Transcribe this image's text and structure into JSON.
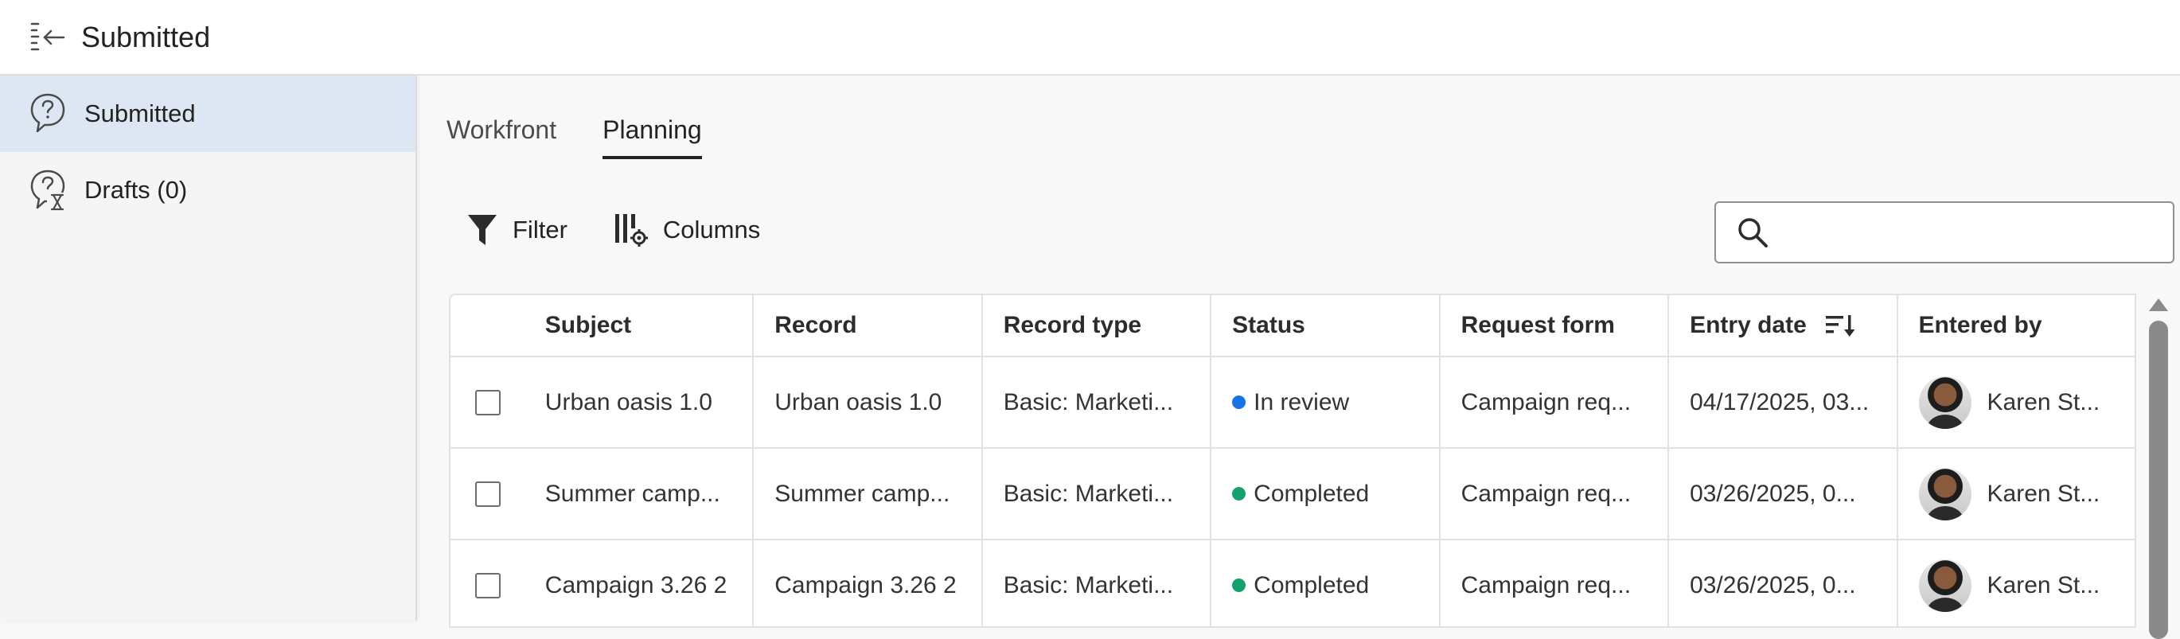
{
  "header": {
    "title": "Submitted"
  },
  "sidebar": {
    "items": [
      {
        "label": "Submitted",
        "active": true,
        "icon": "question-bubble-icon"
      },
      {
        "label": "Drafts (0)",
        "active": false,
        "icon": "hourglass-bubble-icon"
      }
    ]
  },
  "tabs": [
    {
      "label": "Workfront",
      "active": false
    },
    {
      "label": "Planning",
      "active": true
    }
  ],
  "toolbar": {
    "filter_label": "Filter",
    "columns_label": "Columns"
  },
  "search": {
    "placeholder": "",
    "value": ""
  },
  "table": {
    "columns": [
      "Subject",
      "Record",
      "Record type",
      "Status",
      "Request form",
      "Entry date",
      "Entered by"
    ],
    "rows": [
      {
        "subject": "Urban oasis 1.0",
        "record": "Urban oasis 1.0",
        "record_type": "Basic: Marketi...",
        "status": "In review",
        "request_form": "Campaign req...",
        "entry_date": "04/17/2025, 03...",
        "entered_by": "Karen St..."
      },
      {
        "subject": "Summer camp...",
        "record": "Summer camp...",
        "record_type": "Basic: Marketi...",
        "status": "Completed",
        "request_form": "Campaign req...",
        "entry_date": "03/26/2025, 0...",
        "entered_by": "Karen St..."
      },
      {
        "subject": "Campaign 3.26 2",
        "record": "Campaign 3.26 2",
        "record_type": "Basic: Marketi...",
        "status": "Completed",
        "request_form": "Campaign req...",
        "entry_date": "03/26/2025, 0...",
        "entered_by": "Karen St..."
      }
    ]
  },
  "colors": {
    "in_review": "#1473e6",
    "completed": "#12a26c",
    "active_nav": "#dde7f3"
  }
}
